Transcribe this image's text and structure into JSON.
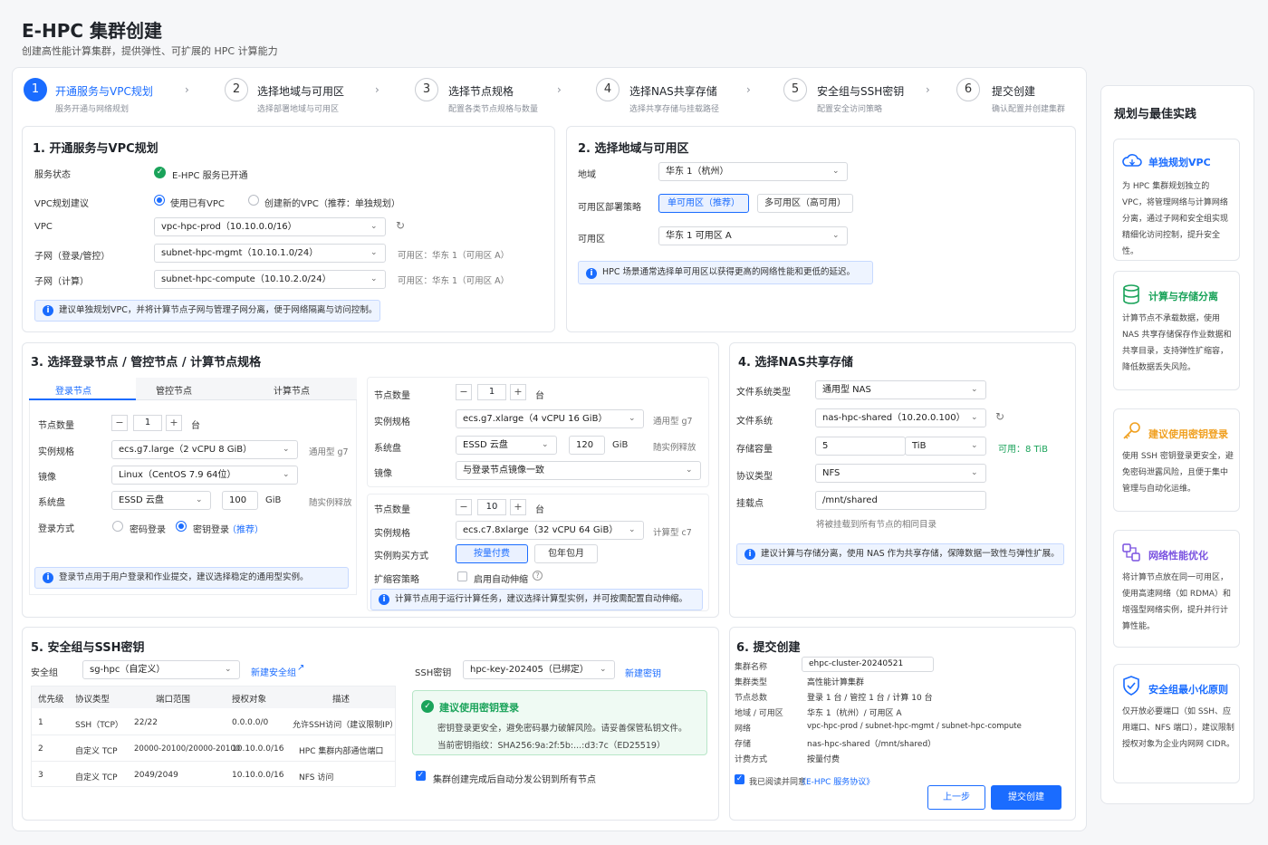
{
  "header": {
    "title": "E-HPC 集群创建",
    "subtitle": "创建高性能计算集群，提供弹性、可扩展的 HPC 计算能力"
  },
  "steps": [
    {
      "num": "1",
      "title": "开通服务与VPC规划",
      "sub": "服务开通与网络规划"
    },
    {
      "num": "2",
      "title": "选择地域与可用区",
      "sub": "选择部署地域与可用区"
    },
    {
      "num": "3",
      "title": "选择节点规格",
      "sub": "配置各类节点规格与数量"
    },
    {
      "num": "4",
      "title": "选择NAS共享存储",
      "sub": "选择共享存储与挂载路径"
    },
    {
      "num": "5",
      "title": "安全组与SSH密钥",
      "sub": "配置安全访问策略"
    },
    {
      "num": "6",
      "title": "提交创建",
      "sub": "确认配置并创建集群"
    }
  ],
  "s1": {
    "title": "1. 开通服务与VPC规划",
    "service_label": "服务状态",
    "service_value": "E-HPC 服务已开通",
    "vpcplan_label": "VPC规划建议",
    "vpcplan_opt1": "使用已有VPC",
    "vpcplan_opt2": "创建新的VPC（推荐：单独规划）",
    "vpc_label": "VPC",
    "vpc_value": "vpc-hpc-prod（10.10.0.0/16）",
    "subnet_mgmt_label": "子网（登录/管控）",
    "subnet_mgmt_value": "subnet-hpc-mgmt（10.10.1.0/24）",
    "subnet_mgmt_zone": "可用区：华东 1（可用区 A）",
    "subnet_comp_label": "子网（计算）",
    "subnet_comp_value": "subnet-hpc-compute（10.10.2.0/24）",
    "subnet_comp_zone": "可用区：华东 1（可用区 A）",
    "info": "建议单独规划VPC，并将计算节点子网与管理子网分离，便于网络隔离与访问控制。"
  },
  "s2": {
    "title": "2. 选择地域与可用区",
    "region_label": "地域",
    "region_value": "华东 1（杭州）",
    "strategy_label": "可用区部署策略",
    "strategy_opt1": "单可用区（推荐）",
    "strategy_opt2": "多可用区（高可用）",
    "zone_label": "可用区",
    "zone_value": "华东 1 可用区 A",
    "info": "HPC 场景通常选择单可用区以获得更高的网络性能和更低的延迟。"
  },
  "s3": {
    "title": "3. 选择登录节点 / 管控节点 / 计算节点规格",
    "tabs": [
      "登录节点",
      "管控节点",
      "计算节点"
    ],
    "login": {
      "count_label": "节点数量",
      "count": "1",
      "unit": "台",
      "spec_label": "实例规格",
      "spec_value": "ecs.g7.large（2 vCPU 8 GiB）",
      "spec_type": "通用型 g7",
      "image_label": "镜像",
      "image_value": "Linux（CentOS 7.9 64位）",
      "disk_label": "系统盘",
      "disk_value": "ESSD 云盘",
      "disk_size": "100",
      "disk_unit": "GiB",
      "disk_note": "随实例释放",
      "login_label": "登录方式",
      "login_opt1": "密码登录",
      "login_opt2": "密钥登录",
      "login_opt2_rec": "（推荐）",
      "info": "登录节点用于用户登录和作业提交，建议选择稳定的通用型实例。"
    },
    "mgmt": {
      "count_label": "节点数量",
      "count": "1",
      "unit": "台",
      "spec_label": "实例规格",
      "spec_value": "ecs.g7.xlarge（4 vCPU 16 GiB）",
      "spec_type": "通用型 g7",
      "disk_label": "系统盘",
      "disk_value": "ESSD 云盘",
      "disk_size": "120",
      "disk_unit": "GiB",
      "disk_note": "随实例释放",
      "image_label": "镜像",
      "image_value": "与登录节点镜像一致"
    },
    "compute": {
      "count_label": "节点数量",
      "count": "10",
      "unit": "台",
      "spec_label": "实例规格",
      "spec_value": "ecs.c7.8xlarge（32 vCPU 64 GiB）",
      "spec_type": "计算型 c7",
      "buy_label": "实例购买方式",
      "buy_opt1": "按量付费",
      "buy_opt2": "包年包月",
      "scale_label": "扩缩容策略",
      "scale_opt": "启用自动伸缩",
      "info": "计算节点用于运行计算任务，建议选择计算型实例，并可按需配置自动伸缩。"
    }
  },
  "s4": {
    "title": "4. 选择NAS共享存储",
    "fstype_label": "文件系统类型",
    "fstype_value": "通用型 NAS",
    "fs_label": "文件系统",
    "fs_value": "nas-hpc-shared（10.20.0.100）",
    "cap_label": "存储容量",
    "cap_value": "5",
    "cap_unit": "TiB",
    "cap_avail": "可用：8 TiB",
    "proto_label": "协议类型",
    "proto_value": "NFS",
    "mount_label": "挂载点",
    "mount_value": "/mnt/shared",
    "mount_note": "将被挂载到所有节点的相同目录",
    "info": "建议计算与存储分离，使用 NAS 作为共享存储，保障数据一致性与弹性扩展。"
  },
  "s5": {
    "title": "5. 安全组与SSH密钥",
    "sg_label": "安全组",
    "sg_value": "sg-hpc（自定义）",
    "sg_link": "新建安全组",
    "ssh_label": "SSH密钥",
    "ssh_value": "hpc-key-202405（已绑定）",
    "ssh_link": "新建密钥",
    "table_headers": [
      "优先级",
      "协议类型",
      "端口范围",
      "授权对象",
      "描述"
    ],
    "rows": [
      [
        "1",
        "SSH（TCP）",
        "22/22",
        "0.0.0.0/0",
        "允许SSH访问（建议限制IP）"
      ],
      [
        "2",
        "自定义 TCP",
        "20000-20100/20000-20100",
        "10.10.0.0/16",
        "HPC 集群内部通信端口"
      ],
      [
        "3",
        "自定义 TCP",
        "2049/2049",
        "10.10.0.0/16",
        "NFS 访问"
      ]
    ],
    "key_title": "建议使用密钥登录",
    "key_desc": "密钥登录更安全，避免密码暴力破解风险。请妥善保管私钥文件。",
    "key_fp": "当前密钥指纹：SHA256:9a:2f:5b:...:d3:7c（ED25519）",
    "distribute": "集群创建完成后自动分发公钥到所有节点"
  },
  "s6": {
    "title": "6. 提交创建",
    "name_label": "集群名称",
    "name_value": "ehpc-cluster-20240521",
    "summary": [
      {
        "label": "集群类型",
        "value": "高性能计算集群"
      },
      {
        "label": "节点总数",
        "value": "登录 1 台 / 管控 1 台 / 计算 10 台"
      },
      {
        "label": "地域 / 可用区",
        "value": "华东 1（杭州）/ 可用区 A"
      },
      {
        "label": "网络",
        "value": "vpc-hpc-prod / subnet-hpc-mgmt / subnet-hpc-compute"
      },
      {
        "label": "存储",
        "value": "nas-hpc-shared（/mnt/shared）"
      },
      {
        "label": "计费方式",
        "value": "按量付费"
      }
    ],
    "agree_prefix": "我已阅读并同意",
    "agree_link": "《E-HPC 服务协议》",
    "prev": "上一步",
    "submit": "提交创建"
  },
  "side": {
    "title": "规划与最佳实践",
    "tips": [
      {
        "title": "单独规划VPC",
        "body": "为 HPC 集群规划独立的 VPC，将管理网络与计算网络分离，通过子网和安全组实现精细化访问控制，提升安全性。",
        "color": "#1a6cff"
      },
      {
        "title": "计算与存储分离",
        "body": "计算节点不承载数据，使用 NAS 共享存储保存作业数据和共享目录，支持弹性扩缩容，降低数据丢失风险。",
        "color": "#1aa35a"
      },
      {
        "title": "建议使用密钥登录",
        "body": "使用 SSH 密钥登录更安全，避免密码泄露风险，且便于集中管理与自动化运维。",
        "color": "#f0a020"
      },
      {
        "title": "网络性能优化",
        "body": "将计算节点放在同一可用区，使用高速网络（如 RDMA）和增强型网络实例，提升并行计算性能。",
        "color": "#7a52e0"
      },
      {
        "title": "安全组最小化原则",
        "body": "仅开放必要端口（如 SSH、应用端口、NFS 端口），建议限制授权对象为企业内网网 CIDR。",
        "color": "#1a6cff"
      }
    ]
  },
  "colors": {
    "primary": "#1a6cff",
    "success": "#1aa35a"
  }
}
